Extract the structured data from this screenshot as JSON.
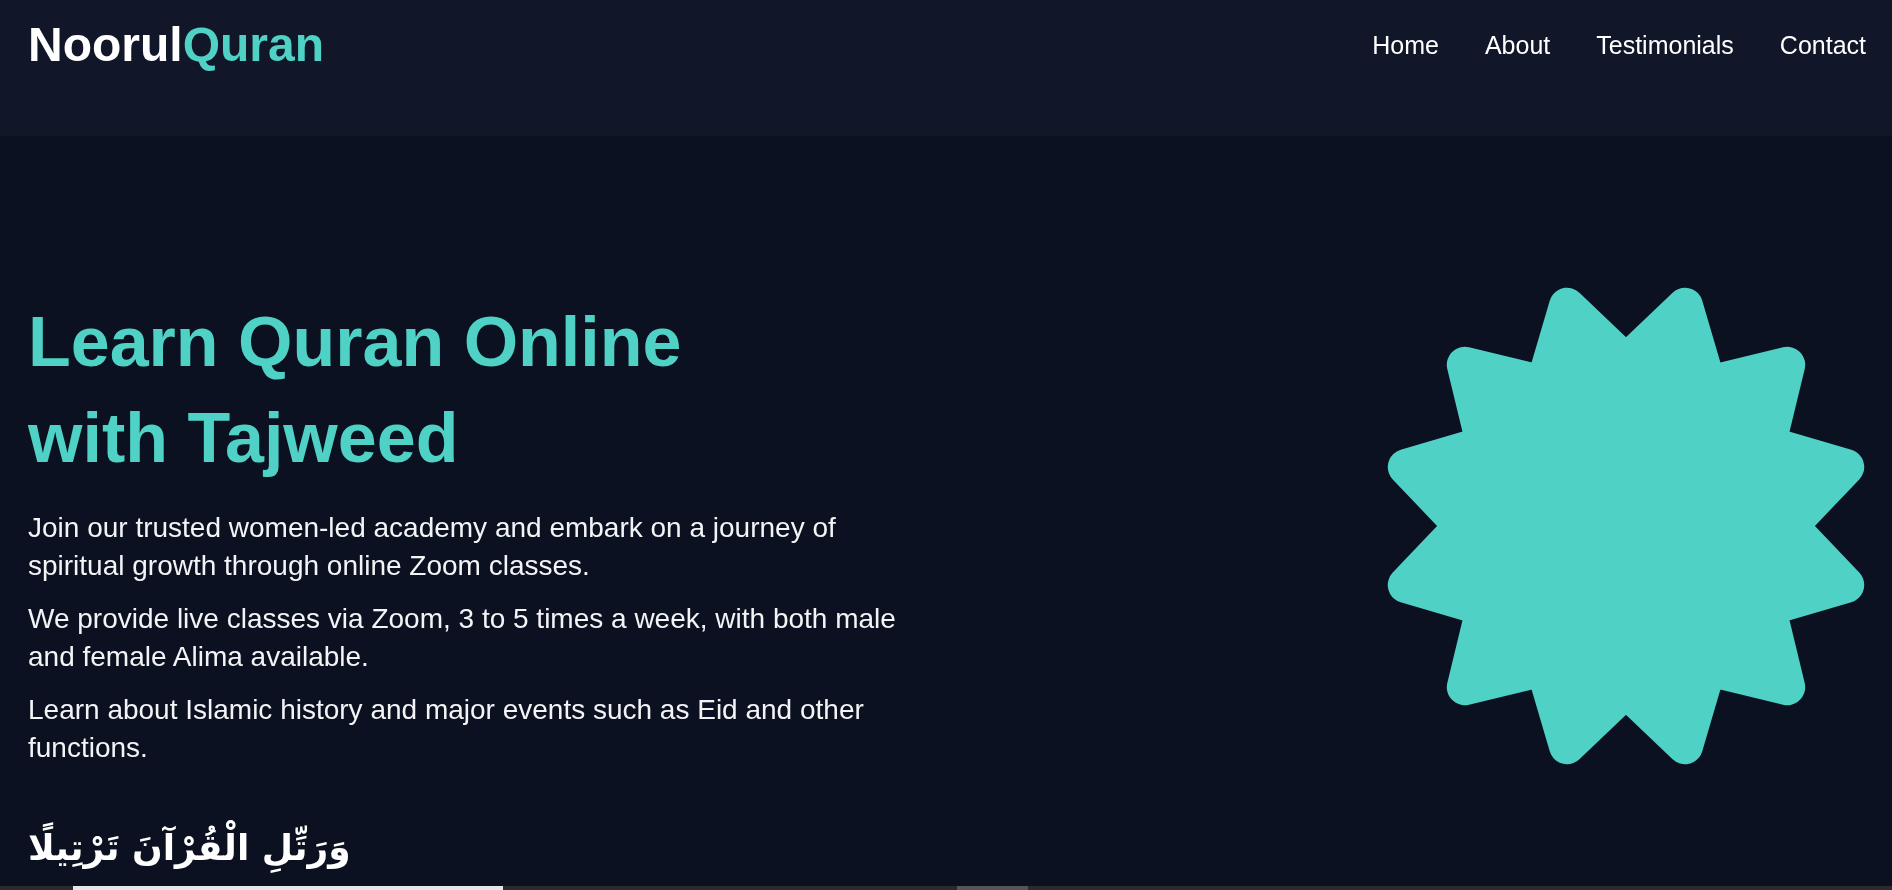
{
  "header": {
    "logo": {
      "main": "Noorul",
      "highlight": "Quran"
    },
    "nav": [
      {
        "label": "Home"
      },
      {
        "label": "About"
      },
      {
        "label": "Testimonials"
      },
      {
        "label": "Contact"
      }
    ]
  },
  "hero": {
    "title": "Learn Quran Online with Tajweed",
    "paragraphs": [
      "Join our trusted women-led academy and embark on a journey of spiritual growth through online Zoom classes.",
      "We provide live classes via Zoom, 3 to 5 times a week, with both male and female Alima available.",
      "Learn about Islamic history and major events such as Eid and other functions."
    ],
    "verse": "وَرَتِّلِ الْقُرْآنَ تَرْتِيلًا"
  }
}
